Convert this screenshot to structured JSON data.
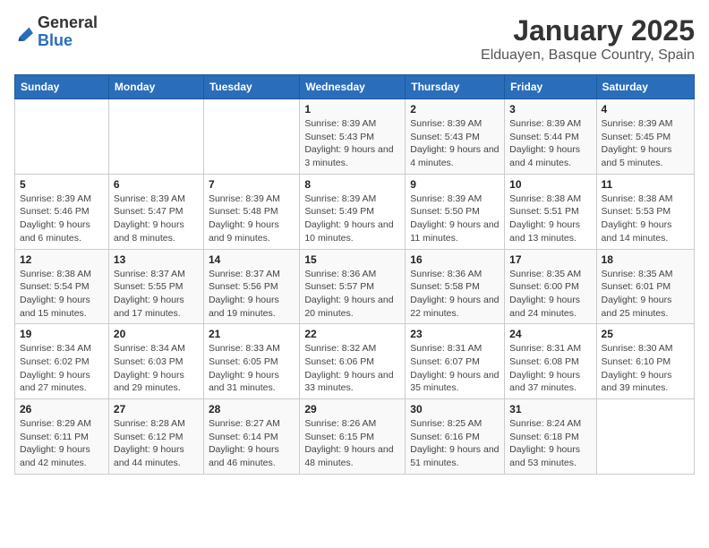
{
  "logo": {
    "text_general": "General",
    "text_blue": "Blue"
  },
  "title": "January 2025",
  "subtitle": "Elduayen, Basque Country, Spain",
  "days_of_week": [
    "Sunday",
    "Monday",
    "Tuesday",
    "Wednesday",
    "Thursday",
    "Friday",
    "Saturday"
  ],
  "weeks": [
    [
      {
        "day": "",
        "info": ""
      },
      {
        "day": "",
        "info": ""
      },
      {
        "day": "",
        "info": ""
      },
      {
        "day": "1",
        "info": "Sunrise: 8:39 AM\nSunset: 5:43 PM\nDaylight: 9 hours and 3 minutes."
      },
      {
        "day": "2",
        "info": "Sunrise: 8:39 AM\nSunset: 5:43 PM\nDaylight: 9 hours and 4 minutes."
      },
      {
        "day": "3",
        "info": "Sunrise: 8:39 AM\nSunset: 5:44 PM\nDaylight: 9 hours and 4 minutes."
      },
      {
        "day": "4",
        "info": "Sunrise: 8:39 AM\nSunset: 5:45 PM\nDaylight: 9 hours and 5 minutes."
      }
    ],
    [
      {
        "day": "5",
        "info": "Sunrise: 8:39 AM\nSunset: 5:46 PM\nDaylight: 9 hours and 6 minutes."
      },
      {
        "day": "6",
        "info": "Sunrise: 8:39 AM\nSunset: 5:47 PM\nDaylight: 9 hours and 8 minutes."
      },
      {
        "day": "7",
        "info": "Sunrise: 8:39 AM\nSunset: 5:48 PM\nDaylight: 9 hours and 9 minutes."
      },
      {
        "day": "8",
        "info": "Sunrise: 8:39 AM\nSunset: 5:49 PM\nDaylight: 9 hours and 10 minutes."
      },
      {
        "day": "9",
        "info": "Sunrise: 8:39 AM\nSunset: 5:50 PM\nDaylight: 9 hours and 11 minutes."
      },
      {
        "day": "10",
        "info": "Sunrise: 8:38 AM\nSunset: 5:51 PM\nDaylight: 9 hours and 13 minutes."
      },
      {
        "day": "11",
        "info": "Sunrise: 8:38 AM\nSunset: 5:53 PM\nDaylight: 9 hours and 14 minutes."
      }
    ],
    [
      {
        "day": "12",
        "info": "Sunrise: 8:38 AM\nSunset: 5:54 PM\nDaylight: 9 hours and 15 minutes."
      },
      {
        "day": "13",
        "info": "Sunrise: 8:37 AM\nSunset: 5:55 PM\nDaylight: 9 hours and 17 minutes."
      },
      {
        "day": "14",
        "info": "Sunrise: 8:37 AM\nSunset: 5:56 PM\nDaylight: 9 hours and 19 minutes."
      },
      {
        "day": "15",
        "info": "Sunrise: 8:36 AM\nSunset: 5:57 PM\nDaylight: 9 hours and 20 minutes."
      },
      {
        "day": "16",
        "info": "Sunrise: 8:36 AM\nSunset: 5:58 PM\nDaylight: 9 hours and 22 minutes."
      },
      {
        "day": "17",
        "info": "Sunrise: 8:35 AM\nSunset: 6:00 PM\nDaylight: 9 hours and 24 minutes."
      },
      {
        "day": "18",
        "info": "Sunrise: 8:35 AM\nSunset: 6:01 PM\nDaylight: 9 hours and 25 minutes."
      }
    ],
    [
      {
        "day": "19",
        "info": "Sunrise: 8:34 AM\nSunset: 6:02 PM\nDaylight: 9 hours and 27 minutes."
      },
      {
        "day": "20",
        "info": "Sunrise: 8:34 AM\nSunset: 6:03 PM\nDaylight: 9 hours and 29 minutes."
      },
      {
        "day": "21",
        "info": "Sunrise: 8:33 AM\nSunset: 6:05 PM\nDaylight: 9 hours and 31 minutes."
      },
      {
        "day": "22",
        "info": "Sunrise: 8:32 AM\nSunset: 6:06 PM\nDaylight: 9 hours and 33 minutes."
      },
      {
        "day": "23",
        "info": "Sunrise: 8:31 AM\nSunset: 6:07 PM\nDaylight: 9 hours and 35 minutes."
      },
      {
        "day": "24",
        "info": "Sunrise: 8:31 AM\nSunset: 6:08 PM\nDaylight: 9 hours and 37 minutes."
      },
      {
        "day": "25",
        "info": "Sunrise: 8:30 AM\nSunset: 6:10 PM\nDaylight: 9 hours and 39 minutes."
      }
    ],
    [
      {
        "day": "26",
        "info": "Sunrise: 8:29 AM\nSunset: 6:11 PM\nDaylight: 9 hours and 42 minutes."
      },
      {
        "day": "27",
        "info": "Sunrise: 8:28 AM\nSunset: 6:12 PM\nDaylight: 9 hours and 44 minutes."
      },
      {
        "day": "28",
        "info": "Sunrise: 8:27 AM\nSunset: 6:14 PM\nDaylight: 9 hours and 46 minutes."
      },
      {
        "day": "29",
        "info": "Sunrise: 8:26 AM\nSunset: 6:15 PM\nDaylight: 9 hours and 48 minutes."
      },
      {
        "day": "30",
        "info": "Sunrise: 8:25 AM\nSunset: 6:16 PM\nDaylight: 9 hours and 51 minutes."
      },
      {
        "day": "31",
        "info": "Sunrise: 8:24 AM\nSunset: 6:18 PM\nDaylight: 9 hours and 53 minutes."
      },
      {
        "day": "",
        "info": ""
      }
    ]
  ]
}
